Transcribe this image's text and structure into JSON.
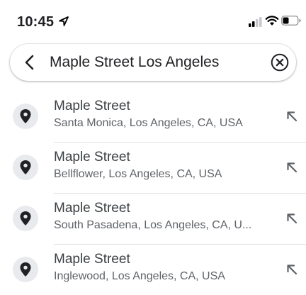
{
  "status_bar": {
    "time": "10:45",
    "icons": [
      "location-arrow-icon",
      "cellular-signal-icon",
      "wifi-icon",
      "battery-icon"
    ]
  },
  "search": {
    "query": "Maple Street Los Angeles",
    "back_icon": "chevron-left-icon",
    "clear_icon": "clear-circle-x-icon"
  },
  "results": [
    {
      "title": "Maple Street",
      "subtitle": "Santa Monica, Los Angeles, CA, USA",
      "icon": "location-pin-icon",
      "action_icon": "arrow-up-left-icon"
    },
    {
      "title": "Maple Street",
      "subtitle": "Bellflower, Los Angeles, CA, USA",
      "icon": "location-pin-icon",
      "action_icon": "arrow-up-left-icon"
    },
    {
      "title": "Maple Street",
      "subtitle": "South Pasadena, Los Angeles, CA, U...",
      "icon": "location-pin-icon",
      "action_icon": "arrow-up-left-icon"
    },
    {
      "title": "Maple Street",
      "subtitle": "Inglewood, Los Angeles, CA, USA",
      "icon": "location-pin-icon",
      "action_icon": "arrow-up-left-icon"
    }
  ],
  "colors": {
    "text_primary": "#202124",
    "text_secondary": "#5f6368",
    "icon_bg": "#e8eaed",
    "divider": "#e0e0e0"
  }
}
